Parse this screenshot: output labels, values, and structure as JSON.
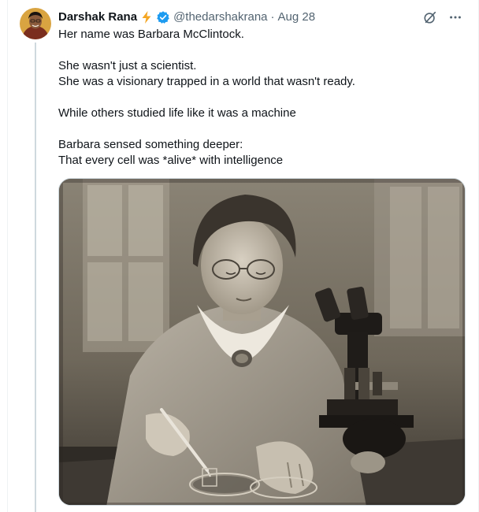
{
  "tweet": {
    "author": {
      "display_name": "Darshak Rana",
      "handle": "@thedarshakrana",
      "badge_emoji": "lightning-icon",
      "verified_icon": "verified-badge-icon"
    },
    "separator": "·",
    "date": "Aug 28",
    "actions": {
      "grok_icon": "grok-icon",
      "more_icon": "more-icon"
    },
    "body": {
      "line1": "Her name was Barbara McClintock.",
      "line2": "She wasn't just a scientist.",
      "line3": "She was a visionary trapped in a world that wasn't ready.",
      "line4": "While others studied life like it was a machine",
      "line5": "Barbara sensed something deeper:",
      "line6": "That every cell was *alive* with intelligence"
    },
    "media": {
      "type": "photo",
      "description_icon": "photo-icon"
    }
  },
  "colors": {
    "text_primary": "#0f1419",
    "text_secondary": "#536471",
    "verified_blue": "#1d9bf0",
    "lightning_yellow": "#f4a623",
    "thread_line": "#cfd9de"
  }
}
